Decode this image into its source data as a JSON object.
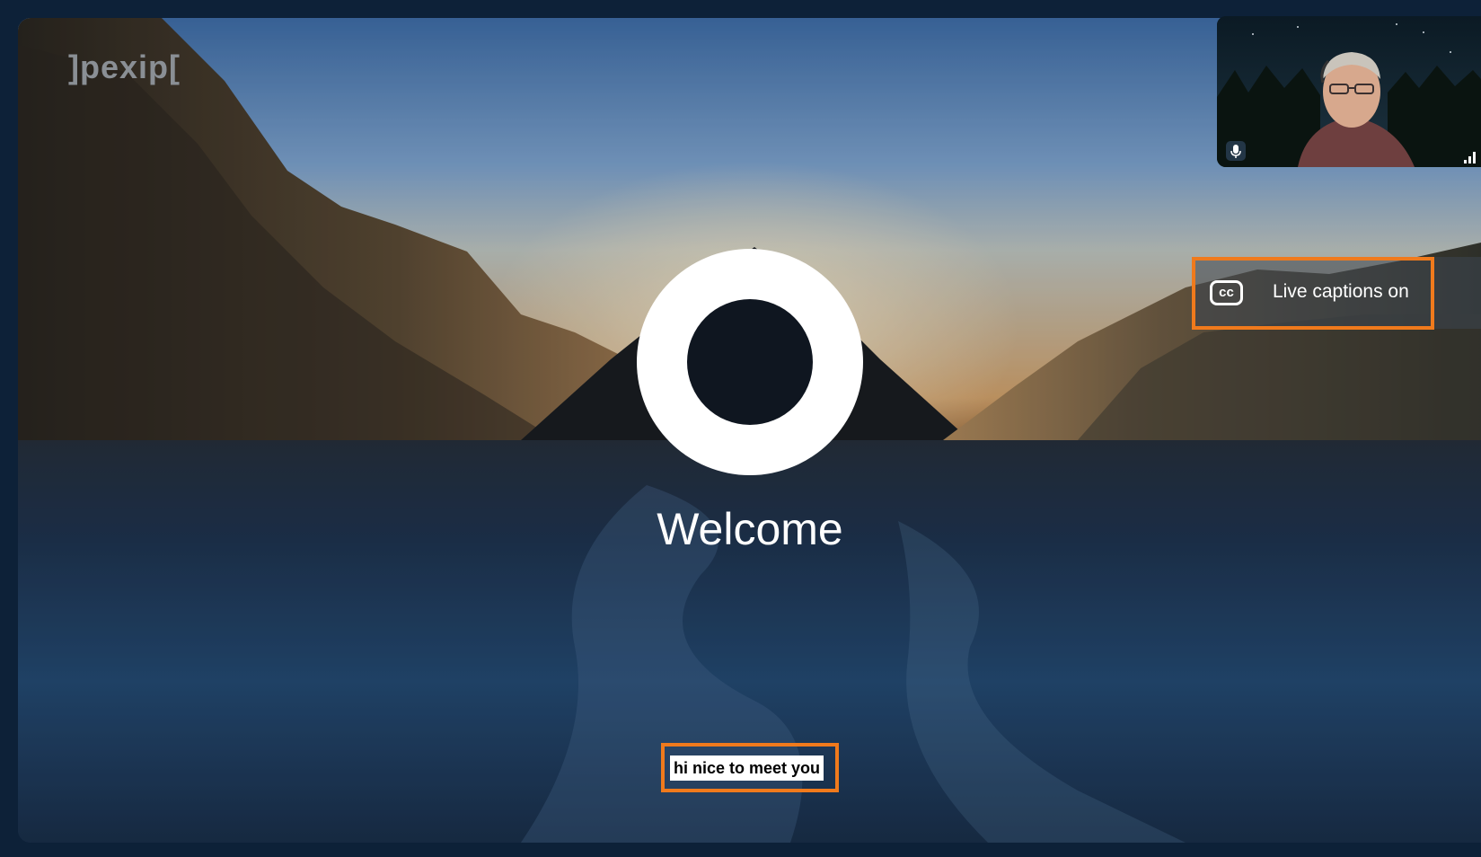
{
  "app": {
    "logo_text": "]pexip["
  },
  "main": {
    "welcome_text": "Welcome"
  },
  "captions": {
    "status_label": "Live captions on",
    "icon_text": "cc",
    "current_caption": "hi nice to meet you"
  },
  "selfview": {
    "mic_icon": "microphone-icon",
    "signal_icon": "signal-strength-icon"
  },
  "colors": {
    "frame_background": "#0d2138",
    "highlight_outline": "#f07a1c",
    "accent_white": "#ffffff"
  }
}
